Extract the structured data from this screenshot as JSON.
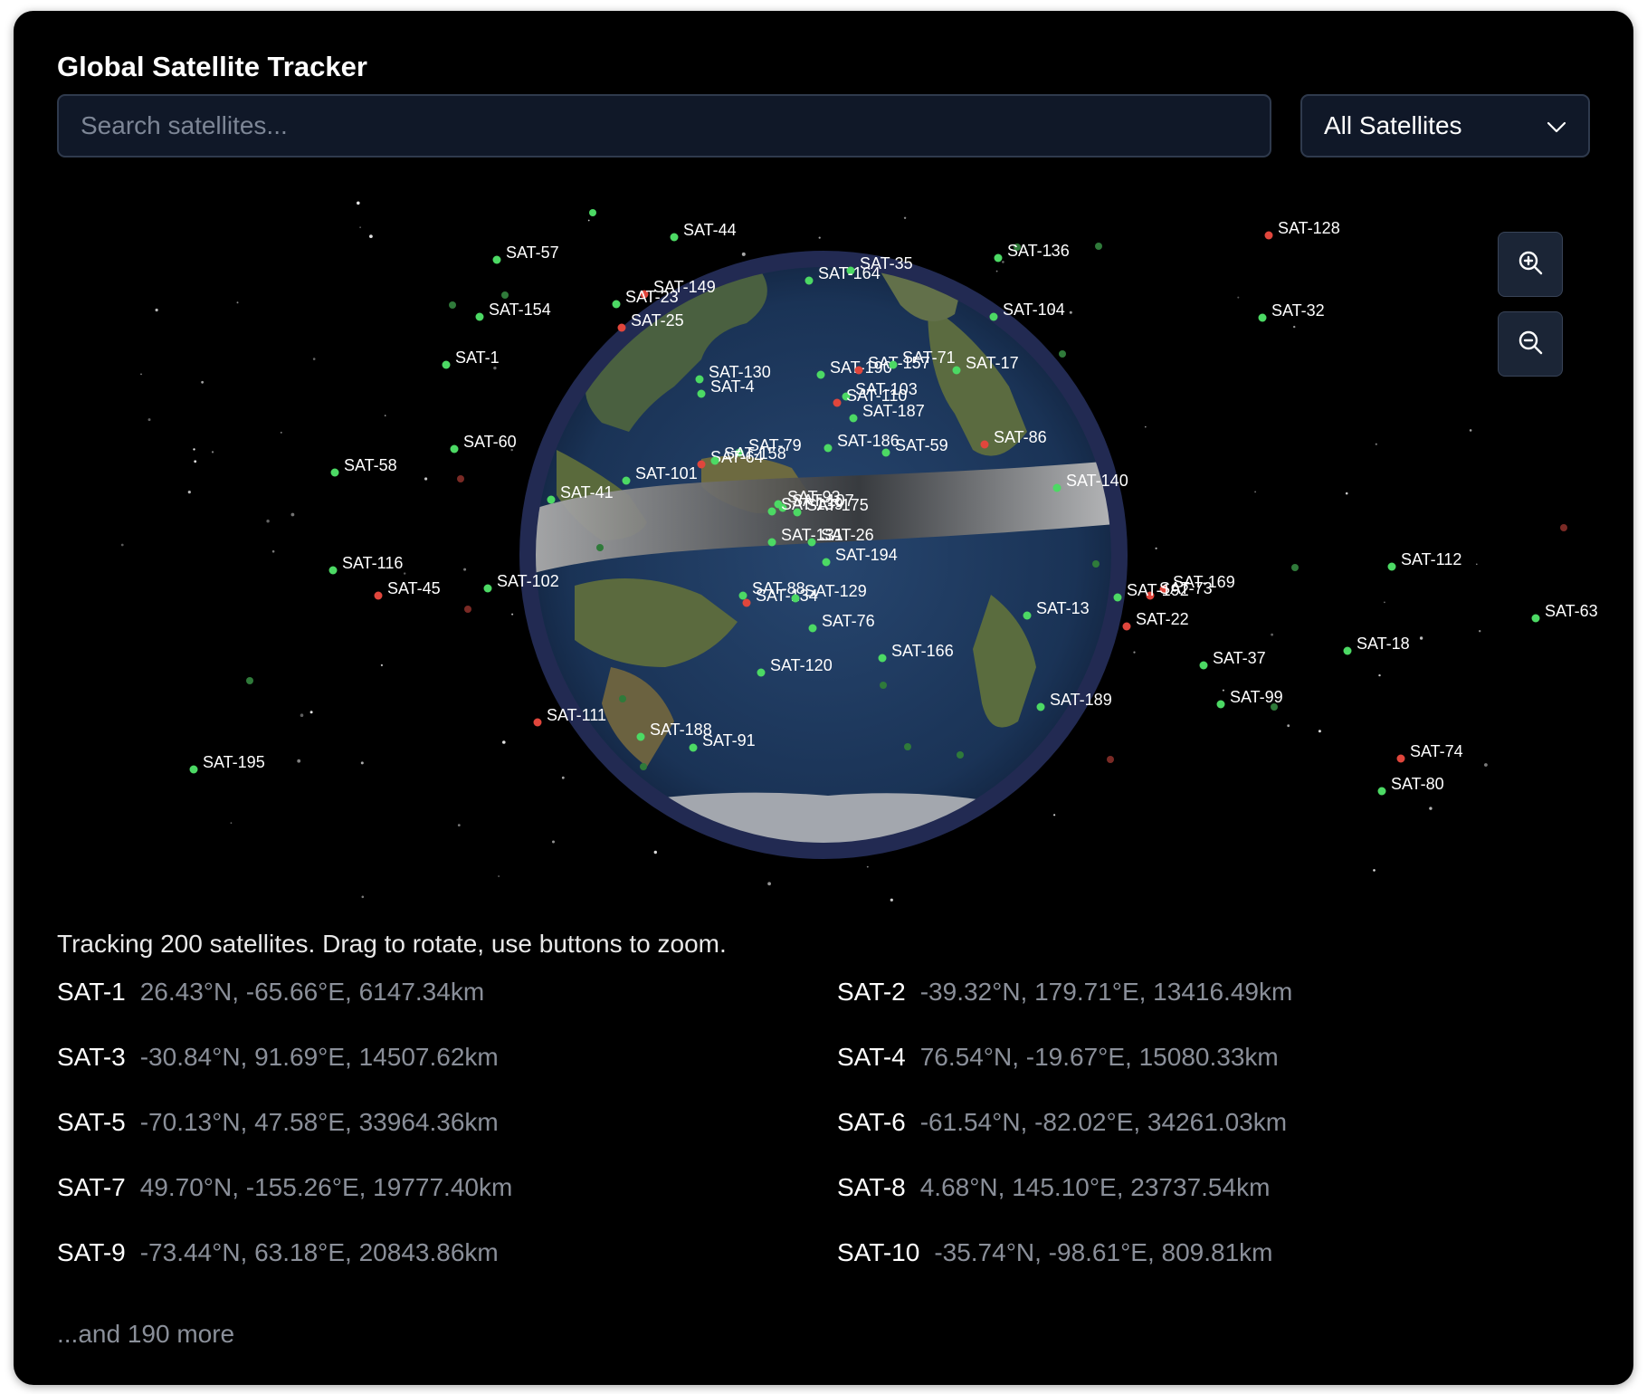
{
  "header": {
    "title": "Global Satellite Tracker"
  },
  "search": {
    "placeholder": "Search satellites...",
    "value": ""
  },
  "filter": {
    "selected": "All Satellites"
  },
  "colors": {
    "active": "#4cd964",
    "warning": "#e0463c",
    "panel": "#000000",
    "input_bg": "#101828"
  },
  "globe_satellites": [
    {
      "name": "SAT-44",
      "status": "active"
    },
    {
      "name": "SAT-57",
      "status": "active"
    },
    {
      "name": "SAT-128",
      "status": "warning"
    },
    {
      "name": "SAT-136",
      "status": "active"
    },
    {
      "name": "SAT-35",
      "status": "active"
    },
    {
      "name": "SAT-164",
      "status": "active"
    },
    {
      "name": "SAT-149",
      "status": "warning"
    },
    {
      "name": "SAT-23",
      "status": "active"
    },
    {
      "name": "SAT-154",
      "status": "active"
    },
    {
      "name": "SAT-25",
      "status": "warning"
    },
    {
      "name": "SAT-104",
      "status": "active"
    },
    {
      "name": "SAT-32",
      "status": "active"
    },
    {
      "name": "SAT-1",
      "status": "active"
    },
    {
      "name": "SAT-190",
      "status": "active"
    },
    {
      "name": "SAT-157",
      "status": "warning"
    },
    {
      "name": "SAT-71",
      "status": "active"
    },
    {
      "name": "SAT-17",
      "status": "active"
    },
    {
      "name": "SAT-130",
      "status": "active"
    },
    {
      "name": "SAT-4",
      "status": "active"
    },
    {
      "name": "SAT-103",
      "status": "active"
    },
    {
      "name": "SAT-110",
      "status": "warning"
    },
    {
      "name": "SAT-187",
      "status": "active"
    },
    {
      "name": "SAT-86",
      "status": "warning"
    },
    {
      "name": "SAT-60",
      "status": "active"
    },
    {
      "name": "SAT-79",
      "status": "active"
    },
    {
      "name": "SAT-186",
      "status": "active"
    },
    {
      "name": "SAT-59",
      "status": "active"
    },
    {
      "name": "SAT-58",
      "status": "active"
    },
    {
      "name": "SAT-64",
      "status": "warning"
    },
    {
      "name": "SAT-158",
      "status": "active"
    },
    {
      "name": "SAT-101",
      "status": "active"
    },
    {
      "name": "SAT-140",
      "status": "active"
    },
    {
      "name": "SAT-41",
      "status": "active"
    },
    {
      "name": "SAT-93",
      "status": "active"
    },
    {
      "name": "SAT-107",
      "status": "active"
    },
    {
      "name": "SAT-139",
      "status": "active"
    },
    {
      "name": "SAT-175",
      "status": "active"
    },
    {
      "name": "SAT-131",
      "status": "active"
    },
    {
      "name": "SAT-26",
      "status": "active"
    },
    {
      "name": "SAT-194",
      "status": "active"
    },
    {
      "name": "SAT-116",
      "status": "active"
    },
    {
      "name": "SAT-112",
      "status": "active"
    },
    {
      "name": "SAT-169",
      "status": "warning"
    },
    {
      "name": "SAT-73",
      "status": "warning"
    },
    {
      "name": "SAT-192",
      "status": "active"
    },
    {
      "name": "SAT-45",
      "status": "warning"
    },
    {
      "name": "SAT-102",
      "status": "active"
    },
    {
      "name": "SAT-88",
      "status": "active"
    },
    {
      "name": "SAT-134",
      "status": "warning"
    },
    {
      "name": "SAT-129",
      "status": "active"
    },
    {
      "name": "SAT-13",
      "status": "active"
    },
    {
      "name": "SAT-22",
      "status": "warning"
    },
    {
      "name": "SAT-63",
      "status": "active"
    },
    {
      "name": "SAT-76",
      "status": "active"
    },
    {
      "name": "SAT-18",
      "status": "active"
    },
    {
      "name": "SAT-166",
      "status": "active"
    },
    {
      "name": "SAT-37",
      "status": "active"
    },
    {
      "name": "SAT-120",
      "status": "active"
    },
    {
      "name": "SAT-189",
      "status": "active"
    },
    {
      "name": "SAT-99",
      "status": "active"
    },
    {
      "name": "SAT-111",
      "status": "warning"
    },
    {
      "name": "SAT-188",
      "status": "active"
    },
    {
      "name": "SAT-91",
      "status": "active"
    },
    {
      "name": "SAT-74",
      "status": "warning"
    },
    {
      "name": "SAT-195",
      "status": "active"
    },
    {
      "name": "SAT-80",
      "status": "active"
    }
  ],
  "status_text": "Tracking 200 satellites. Drag to rotate, use buttons to zoom.",
  "satellite_list": [
    {
      "name": "SAT-1",
      "coords": "26.43°N, -65.66°E, 6147.34km"
    },
    {
      "name": "SAT-2",
      "coords": "-39.32°N, 179.71°E, 13416.49km"
    },
    {
      "name": "SAT-3",
      "coords": "-30.84°N, 91.69°E, 14507.62km"
    },
    {
      "name": "SAT-4",
      "coords": "76.54°N, -19.67°E, 15080.33km"
    },
    {
      "name": "SAT-5",
      "coords": "-70.13°N, 47.58°E, 33964.36km"
    },
    {
      "name": "SAT-6",
      "coords": "-61.54°N, -82.02°E, 34261.03km"
    },
    {
      "name": "SAT-7",
      "coords": "49.70°N, -155.26°E, 19777.40km"
    },
    {
      "name": "SAT-8",
      "coords": "4.68°N, 145.10°E, 23737.54km"
    },
    {
      "name": "SAT-9",
      "coords": "-73.44°N, 63.18°E, 20843.86km"
    },
    {
      "name": "SAT-10",
      "coords": "-35.74°N, -98.61°E, 809.81km"
    }
  ],
  "more_text": "...and 190 more"
}
